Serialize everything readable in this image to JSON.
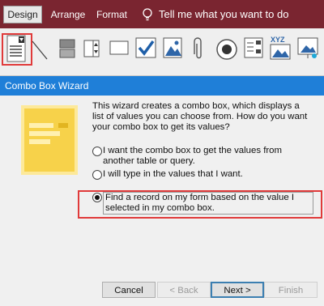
{
  "ribbon_tabs": [
    "Design",
    "Arrange",
    "Format"
  ],
  "tell_me": "Tell me what you want to do",
  "ribbon_icons": [
    "combo-box-icon",
    "line-icon",
    "form-icon",
    "spinner-icon",
    "rectangle-icon",
    "checkbox-icon",
    "image-icon",
    "attachment-icon",
    "option-button-icon",
    "list-box-icon",
    "chart-icon",
    "web-browser-icon"
  ],
  "wizard": {
    "title": "Combo Box Wizard",
    "description": "This wizard creates a combo box, which displays a list of values you can choose from.  How do you want your combo box to get its values?",
    "options": [
      {
        "label": "I want the combo box to get the values from another table or query.",
        "selected": false
      },
      {
        "label": "I will type in the values that I want.",
        "selected": false
      },
      {
        "label": "Find a record on my form based on the value I selected in my combo box.",
        "selected": true
      }
    ],
    "buttons": {
      "cancel": "Cancel",
      "back": "< Back",
      "next": "Next >",
      "finish": "Finish"
    }
  },
  "colors": {
    "tab_bar": "#7a2530",
    "title_bar": "#1f7fd8",
    "highlight": "#e03a3a"
  }
}
